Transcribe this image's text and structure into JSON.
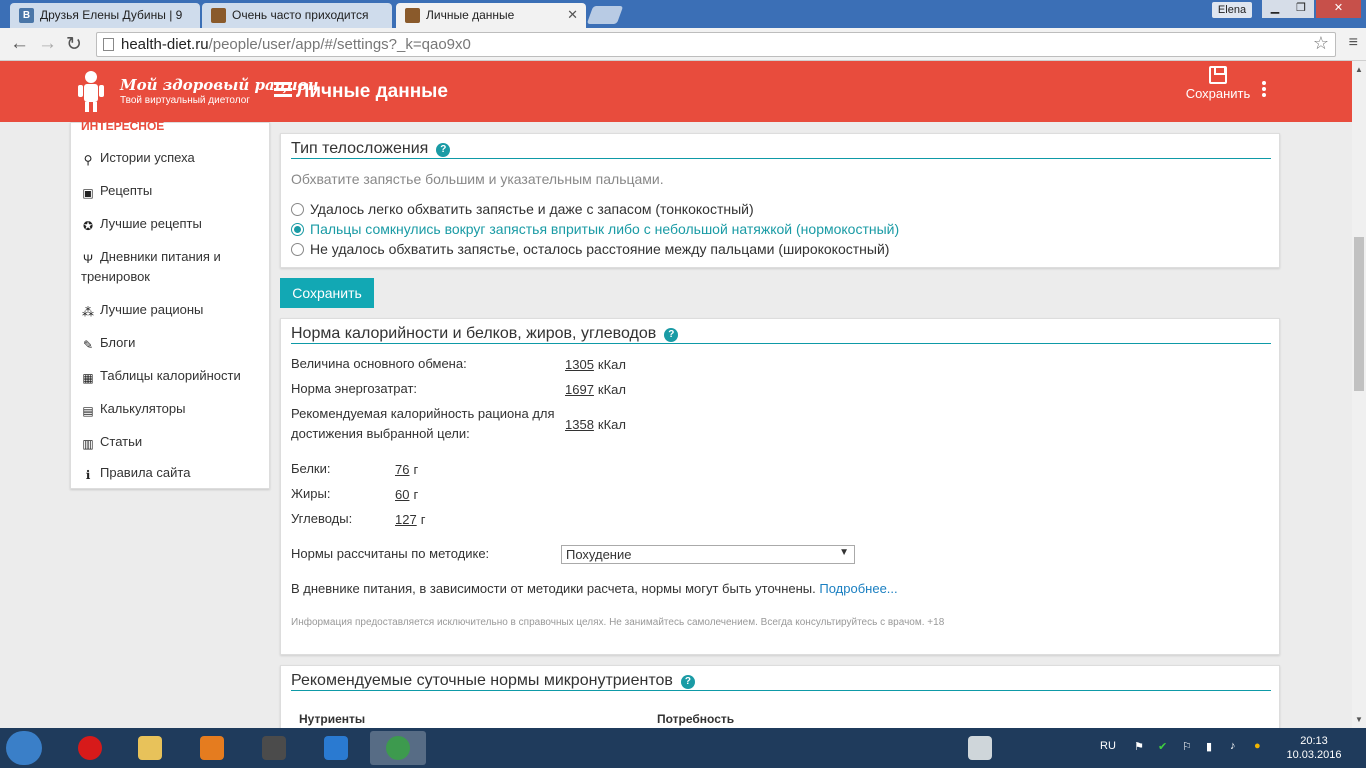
{
  "browser": {
    "tabs": [
      {
        "title": "Друзья Елены Дубины | 9",
        "favicon": "vk-icon",
        "color": "#4a76a8"
      },
      {
        "title": "Очень часто приходится",
        "favicon": "cube-icon",
        "color": "#8a5a2b"
      },
      {
        "title": "Личные данные",
        "favicon": "cube-icon",
        "color": "#8a5a2b"
      }
    ],
    "user": "Elena",
    "url_host": "health-diet.ru",
    "url_path": "/people/user/app/#/settings?_k=qao9x0"
  },
  "header": {
    "logo_title": "Мой здоровый рацион",
    "logo_subtitle": "Твой виртуальный диетолог",
    "page_title": "Личные данные",
    "save_label": "Сохранить",
    "accent": "#e84c3d"
  },
  "sidebar": {
    "section_title": "ИНТЕРЕСНОЕ",
    "items": [
      {
        "label": "Истории успеха",
        "icon": "runner-icon"
      },
      {
        "label": "Рецепты",
        "icon": "recipe-icon"
      },
      {
        "label": "Лучшие рецепты",
        "icon": "medal-icon"
      },
      {
        "label": "Дневники питания и тренировок",
        "icon": "cutlery-icon"
      },
      {
        "label": "Лучшие рационы",
        "icon": "rations-icon"
      },
      {
        "label": "Блоги",
        "icon": "blog-icon"
      },
      {
        "label": "Таблицы калорийности",
        "icon": "table-icon"
      },
      {
        "label": "Калькуляторы",
        "icon": "calculator-icon"
      },
      {
        "label": "Статьи",
        "icon": "article-icon"
      },
      {
        "label": "Правила сайта",
        "icon": "info-icon"
      }
    ]
  },
  "body_type": {
    "title": "Тип телосложения",
    "hint": "Обхватите запястье большим и указательным пальцами.",
    "options": [
      {
        "label": "Удалось легко обхватить запястье и даже с запасом (тонкокостный)",
        "selected": false
      },
      {
        "label": "Пальцы сомкнулись вокруг запястья впритык либо с небольшой натяжкой (нормокостный)",
        "selected": true
      },
      {
        "label": "Не удалось обхватить запястье, осталось расстояние между пальцами (ширококостный)",
        "selected": false
      }
    ],
    "save_button": "Сохранить"
  },
  "norms": {
    "title": "Норма калорийности и белков, жиров, углеводов",
    "rows": [
      {
        "label": "Величина основного обмена:",
        "value": "1305",
        "unit": "кКал"
      },
      {
        "label": "Норма энергозатрат:",
        "value": "1697",
        "unit": "кКал"
      },
      {
        "label": "Рекомендуемая калорийность рациона для достижения выбранной цели:",
        "value": "1358",
        "unit": "кКал"
      }
    ],
    "macros": [
      {
        "label": "Белки:",
        "value": "76",
        "unit": "г"
      },
      {
        "label": "Жиры:",
        "value": "60",
        "unit": "г"
      },
      {
        "label": "Углеводы:",
        "value": "127",
        "unit": "г"
      }
    ],
    "method_label": "Нормы рассчитаны по методике:",
    "method_value": "Похудение",
    "diary_note": "В дневнике питания, в зависимости от методики расчета, нормы могут быть уточнены.",
    "more_link": "Подробнее...",
    "disclaimer": "Информация предоставляется исключительно в справочных целях. Не занимайтесь самолечением. Всегда консультируйтесь с врачом. +18"
  },
  "micro": {
    "title": "Рекомендуемые суточные нормы микронутриентов",
    "col_nutrients": "Нутриенты",
    "col_need": "Потребность"
  },
  "taskbar": {
    "lang": "RU",
    "time": "20:13",
    "date": "10.03.2016"
  }
}
